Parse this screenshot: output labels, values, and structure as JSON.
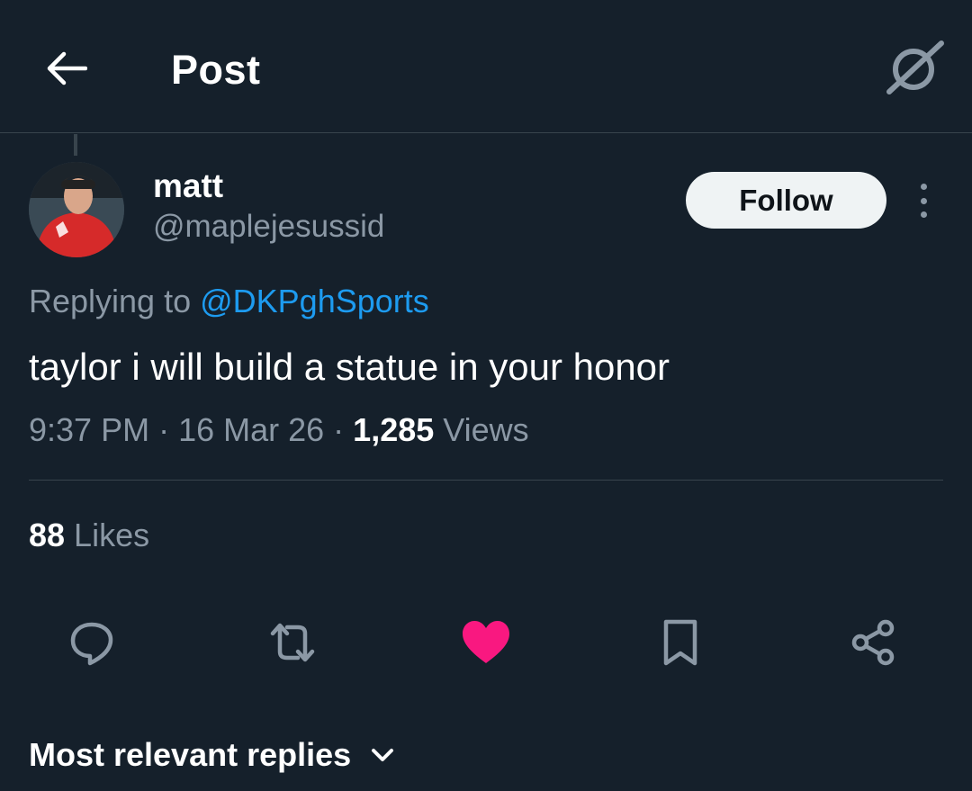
{
  "header": {
    "title": "Post",
    "back_icon": "arrow-left-icon",
    "grok_icon": "grok-icon"
  },
  "author": {
    "name": "matt",
    "handle": "@maplejesussid",
    "avatar_icon": "avatar-image"
  },
  "follow_label": "Follow",
  "replying": {
    "prefix": "Replying to ",
    "mention": "@DKPghSports"
  },
  "tweet": {
    "text": "taylor i will build a statue in your honor"
  },
  "meta": {
    "time": "9:37 PM",
    "sep1": " · ",
    "date": "16 Mar 26",
    "sep2": " · ",
    "views_count": "1,285",
    "views_label": " Views"
  },
  "likes": {
    "count": "88",
    "label": " Likes"
  },
  "actions": [
    {
      "name": "reply",
      "icon": "reply-icon"
    },
    {
      "name": "retweet",
      "icon": "retweet-icon"
    },
    {
      "name": "like",
      "icon": "heart-icon"
    },
    {
      "name": "bookmark",
      "icon": "bookmark-icon"
    },
    {
      "name": "share",
      "icon": "share-icon"
    }
  ],
  "replies_sort": {
    "label": "Most relevant replies"
  },
  "colors": {
    "background": "#15202b",
    "muted": "#8b98a5",
    "link": "#1d9bf0",
    "like": "#f91880",
    "divider": "#38444d"
  }
}
